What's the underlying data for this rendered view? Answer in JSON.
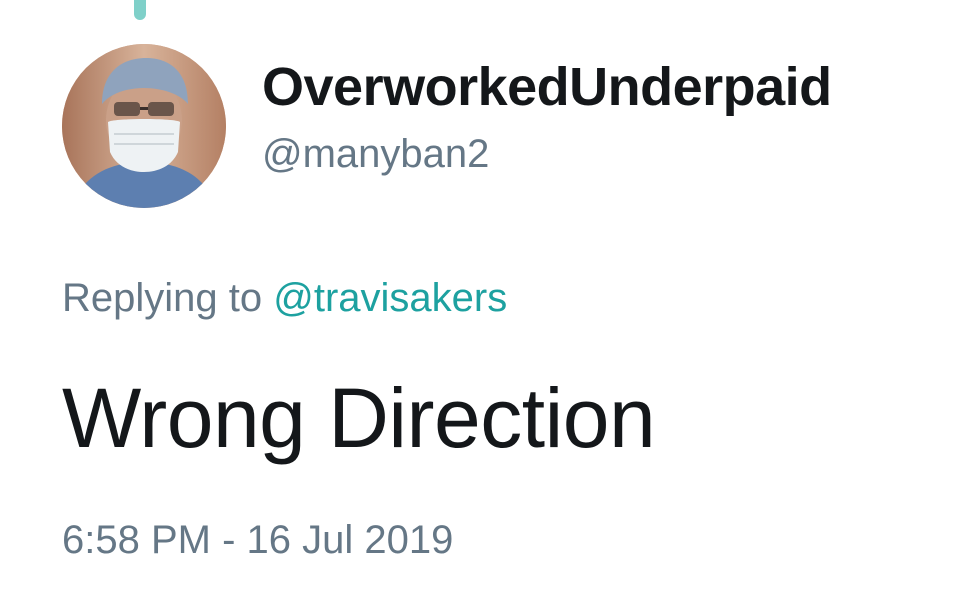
{
  "tweet": {
    "author": {
      "display_name": "OverworkedUnderpaid",
      "handle": "@manyban2",
      "avatar_icon": "profile-photo-surgeon-mask"
    },
    "reply": {
      "prefix": "Replying to",
      "mention": "@travisakers"
    },
    "text": "Wrong Direction",
    "timestamp": "6:58 PM - 16 Jul 2019"
  },
  "colors": {
    "text_primary": "#14171a",
    "text_secondary": "#657786",
    "accent": "#1da1a0",
    "background": "#ffffff"
  }
}
